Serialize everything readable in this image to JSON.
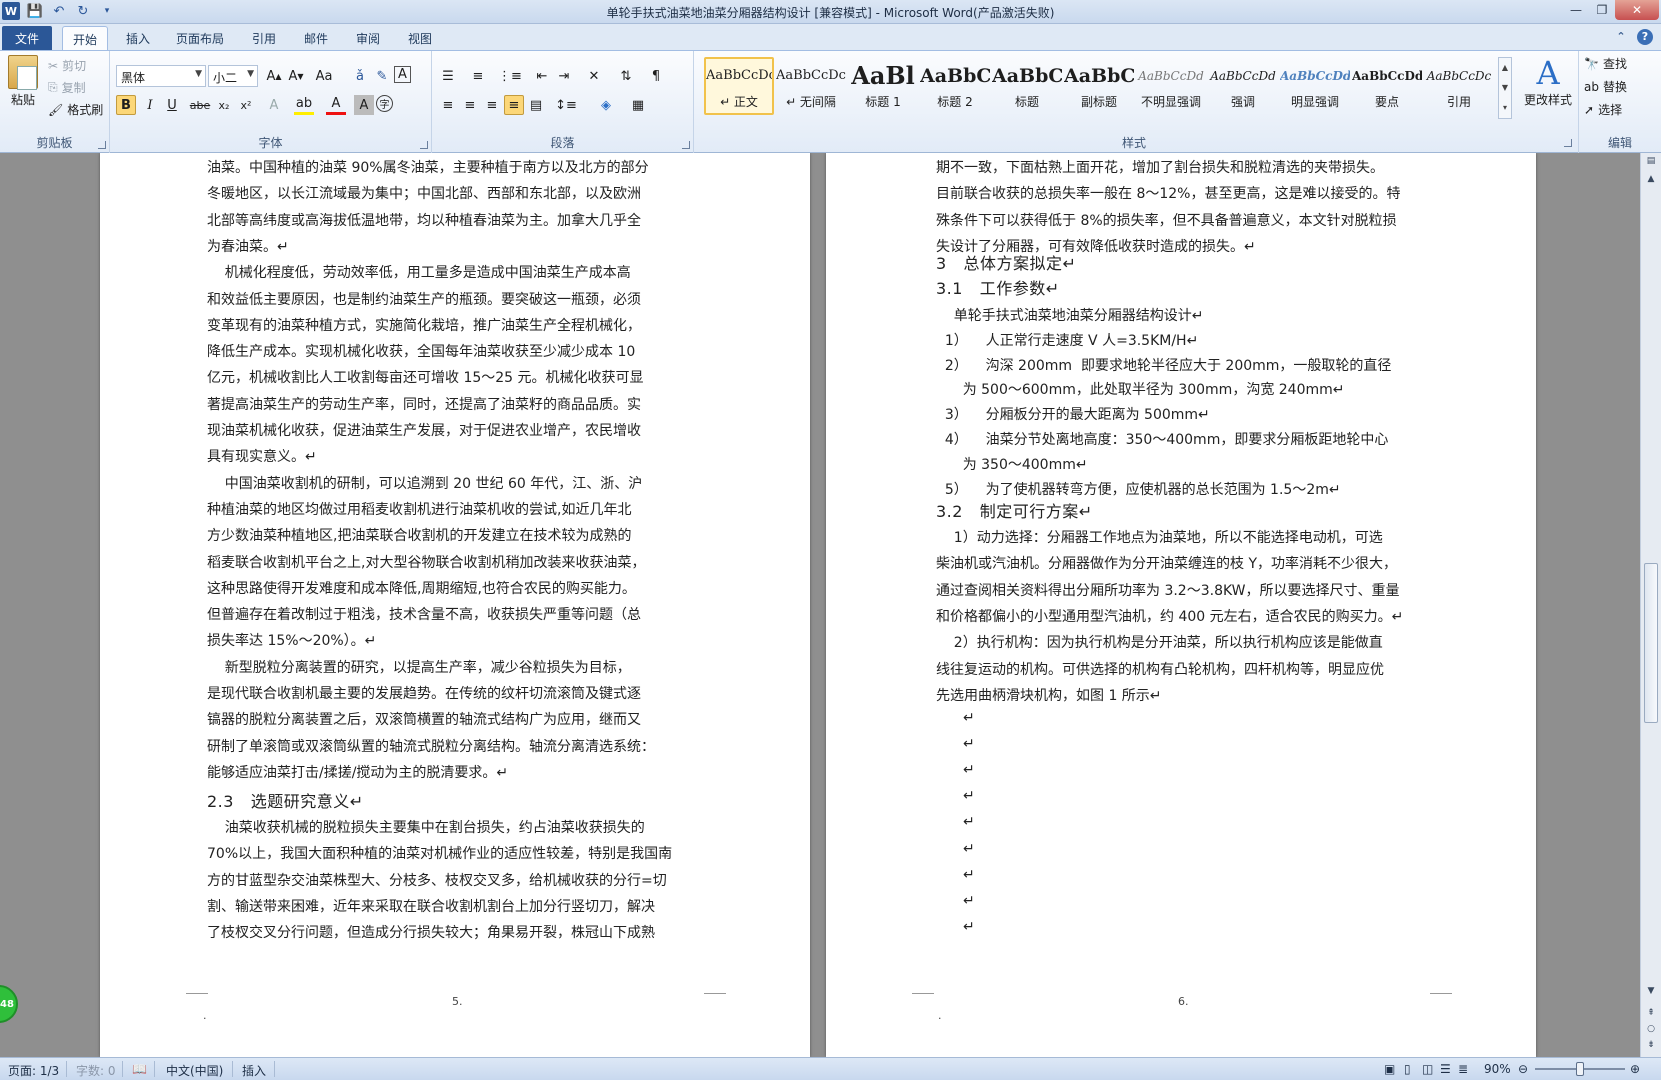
{
  "window": {
    "title": "单轮手扶式油菜地油菜分厢器结构设计 [兼容模式] - Microsoft Word(产品激活失败)",
    "word_logo": "W",
    "min": "—",
    "max": "❐",
    "close": "✕"
  },
  "tabs": [
    "文件",
    "开始",
    "插入",
    "页面布局",
    "引用",
    "邮件",
    "审阅",
    "视图"
  ],
  "ribbon": {
    "clipboard": {
      "paste": "粘贴",
      "cut": "剪切",
      "copy": "复制",
      "format_painter": "格式刷",
      "label": "剪贴板"
    },
    "font": {
      "family": "黑体",
      "size": "小二",
      "label": "字体"
    },
    "paragraph": {
      "label": "段落"
    },
    "styles": {
      "label": "样式",
      "items": [
        {
          "sample": "AaBbCcDc",
          "name": "↵ 正文"
        },
        {
          "sample": "AaBbCcDc",
          "name": "↵ 无间隔"
        },
        {
          "sample": "AaBl",
          "name": "标题 1"
        },
        {
          "sample": "AaBbC",
          "name": "标题 2"
        },
        {
          "sample": "AaBbC",
          "name": "标题"
        },
        {
          "sample": "AaBbC",
          "name": "副标题"
        },
        {
          "sample": "AaBbCcDd",
          "name": "不明显强调"
        },
        {
          "sample": "AaBbCcDd",
          "name": "强调"
        },
        {
          "sample": "AaBbCcDd",
          "name": "明显强调"
        },
        {
          "sample": "AaBbCcDd",
          "name": "要点"
        },
        {
          "sample": "AaBbCcDc",
          "name": "引用"
        }
      ],
      "change_styles": "更改样式"
    },
    "editing": {
      "find": "查找",
      "replace": "替换",
      "select": "选择",
      "label": "编辑"
    }
  },
  "page1": {
    "lines": [
      "油菜。中国种植的油菜 90%属冬油菜，主要种植于南方以及北方的部分",
      "冬暖地区，以长江流域最为集中；中国北部、西部和东北部，以及欧洲",
      "北部等高纬度或高海拔低温地带，均以种植春油菜为主。加拿大几乎全",
      "为春油菜。↵",
      "    机械化程度低，劳动效率低，用工量多是造成中国油菜生产成本高",
      "和效益低主要原因，也是制约油菜生产的瓶颈。要突破这一瓶颈，必须",
      "变革现有的油菜种植方式，实施简化栽培，推广油菜生产全程机械化，",
      "降低生产成本。实现机械化收获，全国每年油菜收获至少减少成本 10",
      "亿元，机械收割比人工收割每亩还可增收 15～25 元。机械化收获可显",
      "著提高油菜生产的劳动生产率，同时，还提高了油菜籽的商品品质。实",
      "现油菜机械化收获，促进油菜生产发展，对于促进农业增产，农民增收",
      "具有现实意义。↵",
      "    中国油菜收割机的研制，可以追溯到 20 世纪 60 年代，江、浙、沪",
      "种植油菜的地区均做过用稻麦收割机进行油菜机收的尝试,如近几年北",
      "方少数油菜种植地区,把油菜联合收割机的开发建立在技术较为成熟的",
      "稻麦联合收割机平台之上,对大型谷物联合收割机稍加改装来收获油菜，",
      "这种思路使得开发难度和成本降低,周期缩短,也符合农民的购买能力。",
      "但普遍存在着改制过于粗浅，技术含量不高，收获损失严重等问题（总",
      "损失率达 15%～20%）。↵",
      "    新型脱粒分离装置的研究，以提高生产率，减少谷粒损失为目标，",
      "是现代联合收割机最主要的发展趋势。在传统的纹杆切流滚筒及键式逐",
      "镐器的脱粒分离装置之后，双滚筒横置的轴流式结构广为应用，继而又",
      "研制了单滚筒或双滚筒纵置的轴流式脱粒分离结构。轴流分离清选系统：",
      "能够适应油菜打击/揉搓/搅动为主的脱清要求。↵"
    ],
    "heading_2_3": "2.3   选题研究意义↵",
    "lines_after": [
      "    油菜收获机械的脱粒损失主要集中在割台损失，约占油菜收获损失的",
      "70%以上，我国大面积种植的油菜对机械作业的适应性较差，特别是我国南",
      "方的甘蓝型杂交油菜株型大、分枝多、枝杈交叉多，给机械收获的分行=切",
      "割、输送带来困难，近年来采取在联合收割机割台上加分行竖切刀，解决",
      "了枝杈交叉分行问题，但造成分行损失较大；角果易开裂，株冠山下成熟"
    ],
    "page_number": "5.",
    "mark": "."
  },
  "page2": {
    "lines": [
      "期不一致，下面枯熟上面开花，增加了割台损失和脱粒清选的夹带损失。",
      "目前联合收获的总损失率一般在 8～12%，甚至更高，这是难以接受的。特",
      "殊条件下可以获得低于 8%的损失率，但不具备普遍意义，本文针对脱粒损",
      "失设计了分厢器，可有效降低收获时造成的损失。↵"
    ],
    "heading_3": "3   总体方案拟定↵",
    "heading_3_1": "3.1   工作参数↵",
    "params": [
      "    单轮手扶式油菜地油菜分厢器结构设计↵",
      "  1）    人正常行走速度 V 人=3.5KM/H↵",
      "  2）    沟深 200mm  即要求地轮半径应大于 200mm，一般取轮的直径",
      "      为 500～600mm，此处取半径为 300mm，沟宽 240mm↵",
      "  3）    分厢板分开的最大距离为 500mm↵",
      "  4）    油菜分节处离地高度：350～400mm，即要求分厢板距地轮中心",
      "      为 350～400mm↵",
      "  5）    为了使机器转弯方便，应使机器的总长范围为 1.5～2m↵"
    ],
    "heading_3_2": "3.2   制定可行方案↵",
    "scheme": [
      "    1）动力选择：分厢器工作地点为油菜地，所以不能选择电动机，可选",
      "柴油机或汽油机。分厢器做作为分开油菜缠连的枝 Y，功率消耗不少很大，",
      "通过查阅相关资料得出分厢所功率为 3.2～3.8KW，所以要选择尺寸、重量",
      "和价格都偏小的小型通用型汽油机，约 400 元左右，适合农民的购买力。↵",
      "    2）执行机构：因为执行机构是分开油菜，所以执行机构应该是能做直",
      "线往复运动的机构。可供选择的机构有凸轮机构，四杆机构等，明显应优",
      "先选用曲柄滑块机构，如图 1 所示↵"
    ],
    "empty_paragraphs": [
      "↵",
      "↵",
      "↵",
      "↵",
      "↵",
      "↵",
      "↵",
      "↵",
      "↵"
    ],
    "page_number": "6.",
    "mark": "."
  },
  "side_badge": "48",
  "status": {
    "page": "页面: 1/3",
    "words": "字数: 0",
    "language": "中文(中国)",
    "insert_mode": "插入",
    "zoom": "90%"
  }
}
